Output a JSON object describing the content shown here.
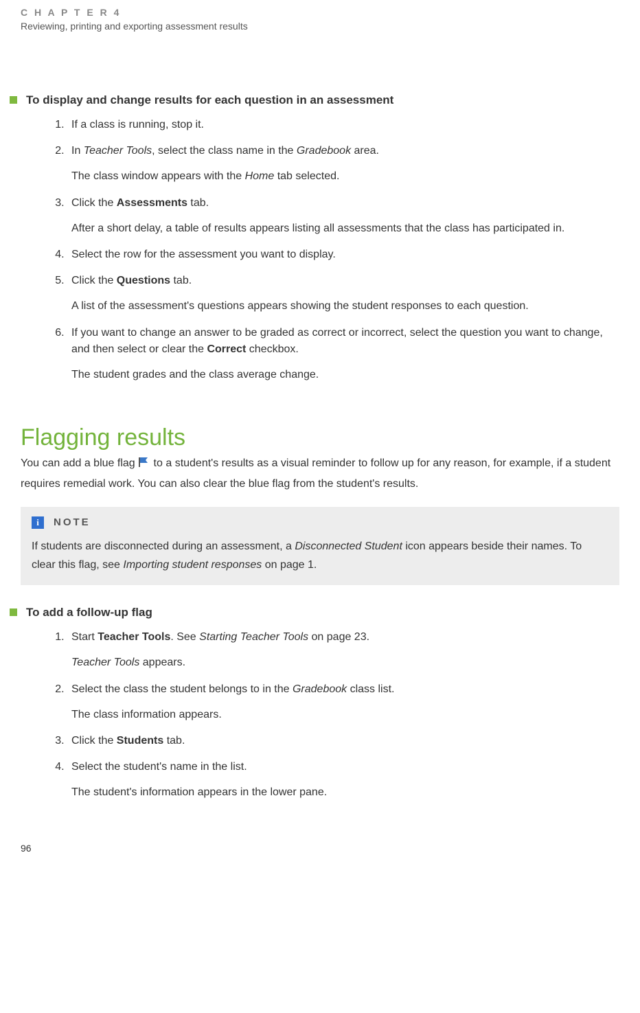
{
  "header": {
    "chapter_label": "C H A P T E R  4",
    "chapter_title": "Reviewing, printing and exporting assessment results"
  },
  "proc1": {
    "title": "To display and change results for each question in an assessment",
    "steps": {
      "s1": "If a class is running, stop it.",
      "s2_a": "In ",
      "s2_b": "Teacher Tools",
      "s2_c": ", select the class name in the ",
      "s2_d": "Gradebook",
      "s2_e": " area.",
      "s2_p": "The class window appears with the ",
      "s2_p_i": "Home",
      "s2_p2": " tab selected.",
      "s3_a": "Click the ",
      "s3_b": "Assessments",
      "s3_c": " tab.",
      "s3_p": "After a short delay, a table of results appears listing all assessments that the class has participated in.",
      "s4": "Select the row for the assessment you want to display.",
      "s5_a": "Click the ",
      "s5_b": "Questions",
      "s5_c": " tab.",
      "s5_p": "A list of the assessment's questions appears showing the student responses to each question.",
      "s6_a": "If you want to change an answer to be graded as correct or incorrect, select the question you want to change, and then select or clear the ",
      "s6_b": "Correct",
      "s6_c": " checkbox.",
      "s6_p": "The student grades and the class average change."
    }
  },
  "section2": {
    "title": "Flagging results",
    "intro_a": "You can add a blue flag ",
    "intro_b": " to a student's results as a visual reminder to follow up for any reason, for example, if a student requires remedial work. You can also clear the blue flag from the student's results."
  },
  "note": {
    "label": "NOTE",
    "body_a": "If students are disconnected during an assessment, a ",
    "body_b": "Disconnected Student",
    "body_c": " icon appears beside their names. To clear this flag, see ",
    "body_d": "Importing student responses",
    "body_e": " on page 1."
  },
  "proc2": {
    "title": "To add a follow-up flag",
    "steps": {
      "s1_a": "Start ",
      "s1_b": "Teacher Tools",
      "s1_c": ". See ",
      "s1_d": "Starting Teacher Tools",
      "s1_e": " on page 23.",
      "s1_p_a": "Teacher Tools",
      "s1_p_b": " appears.",
      "s2_a": "Select the class the student belongs to in the ",
      "s2_b": "Gradebook",
      "s2_c": " class list.",
      "s2_p": "The class information appears.",
      "s3_a": "Click the ",
      "s3_b": "Students",
      "s3_c": " tab.",
      "s4": "Select the student's name in the list.",
      "s4_p": "The student's information appears in the lower pane."
    }
  },
  "page_number": "96"
}
